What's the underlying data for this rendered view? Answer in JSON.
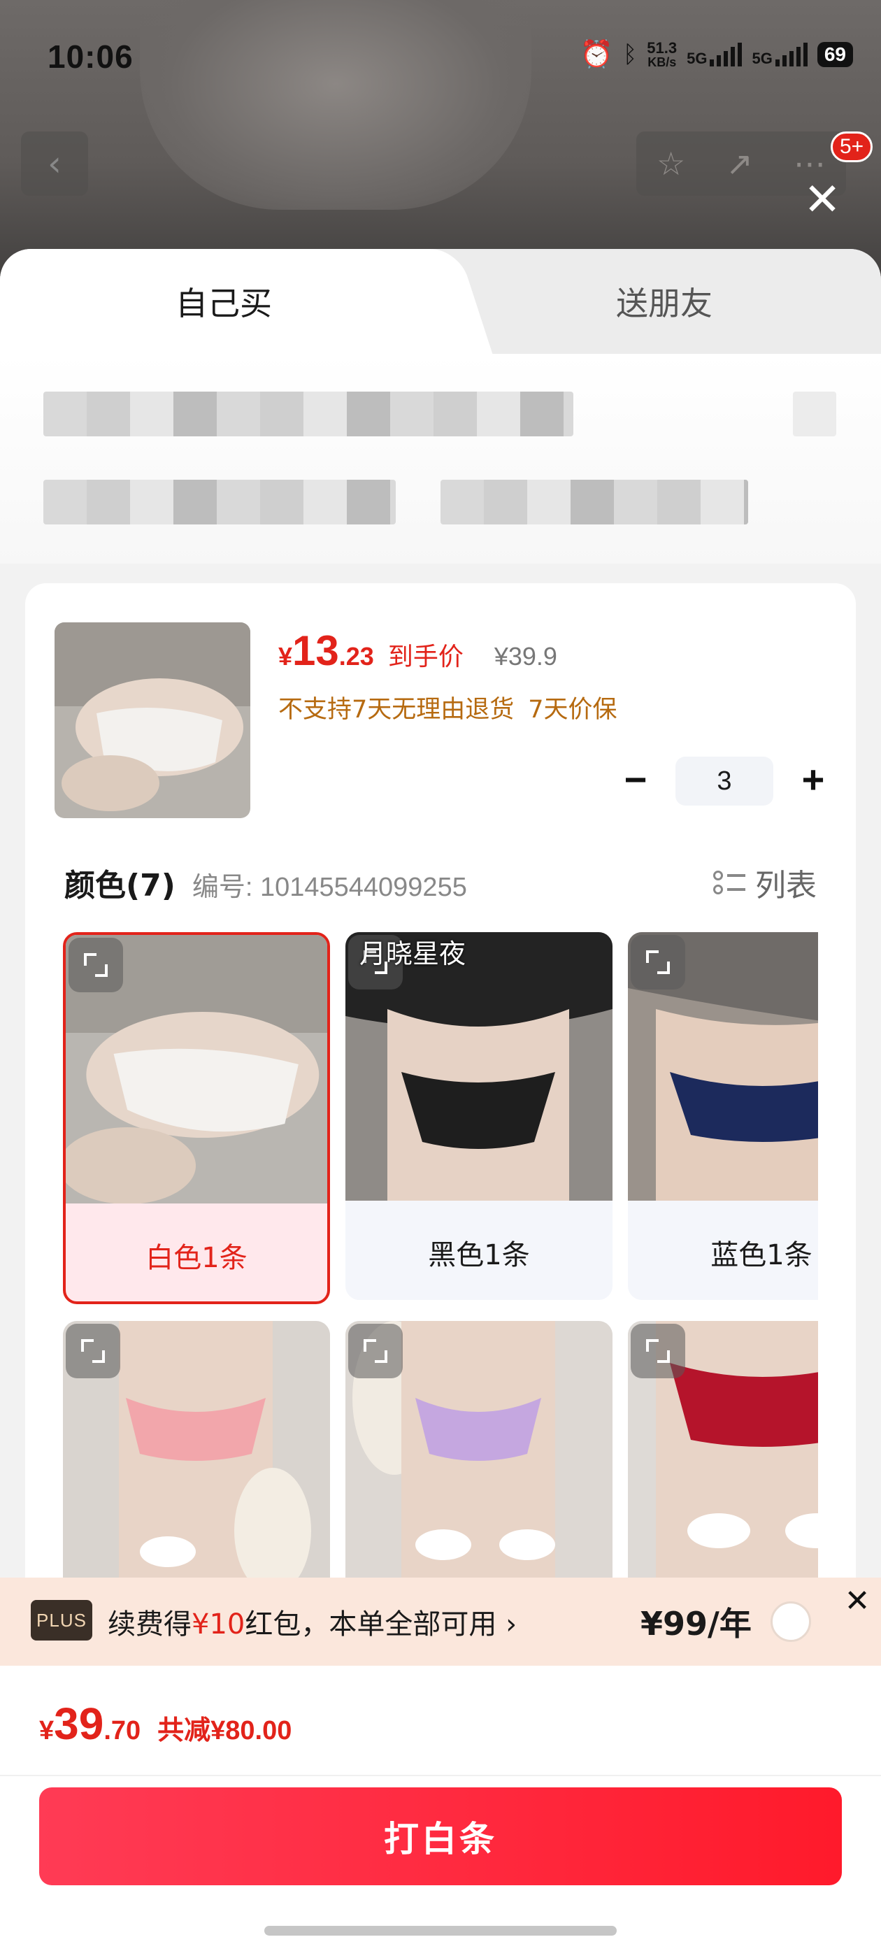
{
  "status_bar": {
    "time": "10:06",
    "net_speed_value": "51.3",
    "net_speed_unit": "KB/s",
    "sim1": "5G",
    "sim2": "5G",
    "battery": "69"
  },
  "background": {
    "cart_badge": "5+"
  },
  "tabs": [
    {
      "label": "自己买",
      "active": true
    },
    {
      "label": "送朋友",
      "active": false
    }
  ],
  "product": {
    "price_symbol": "¥",
    "price_int": "13",
    "price_dec": ".23",
    "price_label": "到手价",
    "original_price": "¥39.9",
    "notices": [
      "不支持7天无理由退货",
      "7天价保"
    ],
    "quantity": "3"
  },
  "color_section": {
    "title": "颜色(7)",
    "code": "编号: 10145544099255",
    "list_label": "列表",
    "watermark": "月晓星夜",
    "options": [
      {
        "label": "白色1条",
        "selected": true
      },
      {
        "label": "黑色1条",
        "selected": false
      },
      {
        "label": "蓝色1条",
        "selected": false
      },
      {
        "label": "",
        "selected": false
      },
      {
        "label": "",
        "selected": false
      },
      {
        "label": "",
        "selected": false
      }
    ]
  },
  "plus": {
    "badge": "PLUS",
    "text_prefix": "续费得",
    "text_amount": "¥10",
    "text_suffix": "红包，本单全部可用",
    "chevron": "›",
    "price": "¥99/年"
  },
  "footer": {
    "total_symbol": "¥",
    "total_int": "39",
    "total_dec": ".70",
    "reduction": "共减¥80.00",
    "pay_label": "打白条"
  },
  "colors": {
    "accent": "#e2231a",
    "pay_button": "#ff1a2b",
    "warning": "#b66a10"
  }
}
